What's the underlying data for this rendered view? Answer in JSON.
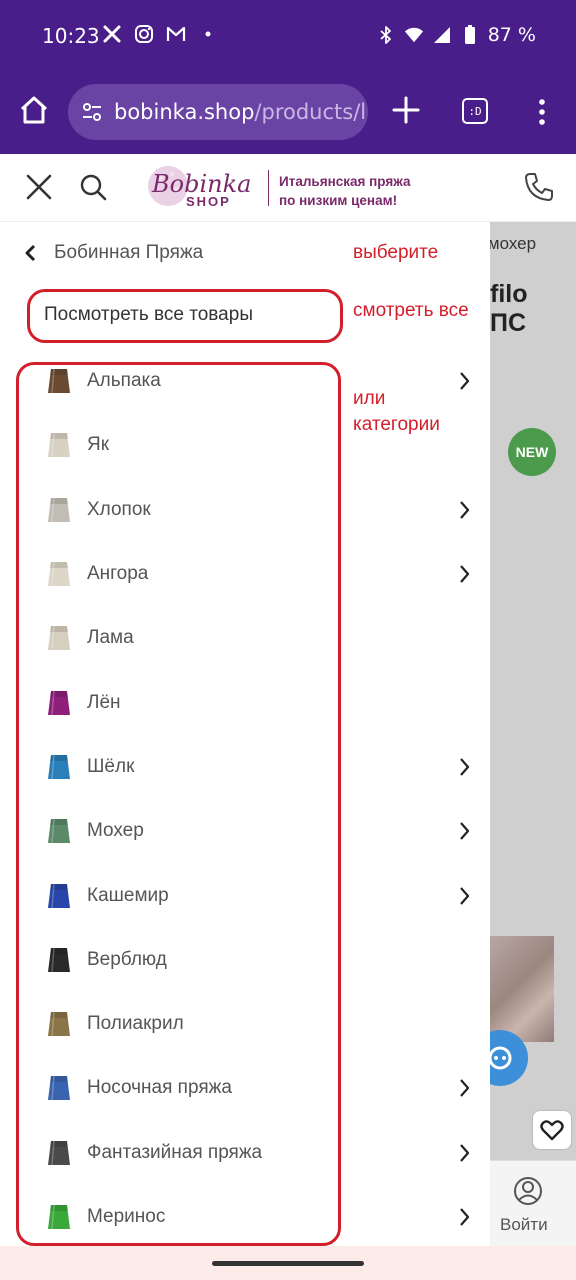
{
  "status_bar": {
    "time": "10:23",
    "battery": "87 %",
    "icons_left": [
      "tools-icon",
      "instagram-icon",
      "gmail-icon",
      "dot-icon"
    ],
    "icons_right": [
      "bluetooth-icon",
      "wifi-icon",
      "signal-icon",
      "battery-icon"
    ]
  },
  "browser": {
    "url_host": "bobinka.shop",
    "url_path": "/products/l",
    "tab_label": ":D"
  },
  "site": {
    "logo_main": "Bobinka",
    "logo_sub": "SHOP",
    "tagline_line1": "Итальянская пряжа",
    "tagline_line2": "по низким ценам!",
    "brand_color": "#7a2a6a"
  },
  "drawer": {
    "back_label": "Бобинная Пряжа",
    "view_all": "Посмотреть все товары",
    "categories": [
      {
        "label": "Альпака",
        "color": "#6b4a32",
        "has_children": true
      },
      {
        "label": "Як",
        "color": "#d9d2c4",
        "has_children": false
      },
      {
        "label": "Хлопок",
        "color": "#c2bdb4",
        "has_children": true
      },
      {
        "label": "Ангора",
        "color": "#ddd6c8",
        "has_children": true
      },
      {
        "label": "Лама",
        "color": "#d6cfbf",
        "has_children": false
      },
      {
        "label": "Лён",
        "color": "#8e1f7a",
        "has_children": false
      },
      {
        "label": "Шёлк",
        "color": "#2a7fb8",
        "has_children": true
      },
      {
        "label": "Мохер",
        "color": "#5a8a6a",
        "has_children": true
      },
      {
        "label": "Кашемир",
        "color": "#2846a8",
        "has_children": true
      },
      {
        "label": "Верблюд",
        "color": "#2a2a2a",
        "has_children": false
      },
      {
        "label": "Полиакрил",
        "color": "#8a7448",
        "has_children": false
      },
      {
        "label": "Носочная пряжа",
        "color": "#3a64b0",
        "has_children": true
      },
      {
        "label": "Фантазийная пряжа",
        "color": "#4a4a4a",
        "has_children": true
      },
      {
        "label": "Меринос",
        "color": "#3aa83a",
        "has_children": true
      }
    ]
  },
  "background_page": {
    "breadcrumb_tail": "дмохер",
    "title_line1": "filo",
    "title_line2": "ПС",
    "badge": "NEW",
    "login_label": "Войти"
  },
  "annotations": {
    "choose": "выберите",
    "see_all": "смотреть все",
    "or": "или",
    "categories": "категории",
    "color": "#d21f2b"
  }
}
